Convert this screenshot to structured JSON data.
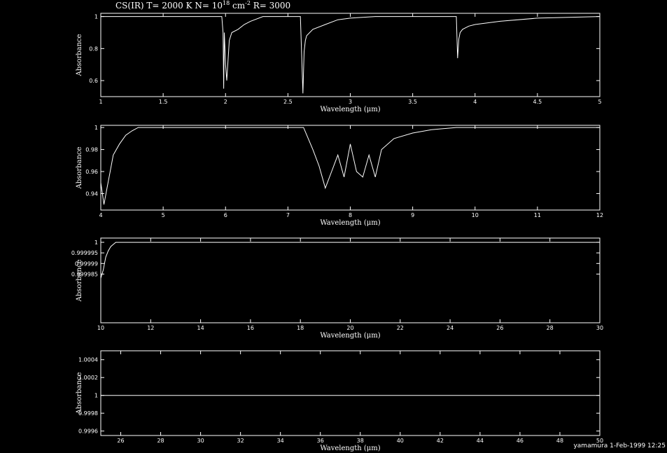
{
  "header": {
    "title_pre": "CS(IR) T= 2000 K N= 10",
    "title_exp1": "18",
    "title_mid": " cm",
    "title_exp2": "-2",
    "title_post": " R= 3000"
  },
  "footer": {
    "credit": "yamamura  1-Feb-1999 12:25"
  },
  "colors": {
    "background": "#000000",
    "foreground": "#ffffff"
  },
  "chart_data": [
    {
      "type": "line",
      "xlabel": "Wavelength (μm)",
      "ylabel": "Absorbance",
      "xlim": [
        1,
        5
      ],
      "ylim": [
        0.5,
        1.02
      ],
      "xticks": [
        1,
        1.5,
        2,
        2.5,
        3,
        3.5,
        4,
        4.5,
        5
      ],
      "xtick_labels": [
        "1",
        "1.5",
        "2",
        "2.5",
        "3",
        "3.5",
        "4",
        "4.5",
        "5"
      ],
      "yticks": [
        0.6,
        0.8,
        1
      ],
      "ytick_labels": [
        "0.6",
        "0.8",
        "1"
      ],
      "series": [
        {
          "x": [
            1.0,
            1.97,
            1.98,
            1.985,
            1.99,
            2.0,
            2.01,
            2.03,
            2.05,
            2.1,
            2.15,
            2.2,
            2.3,
            2.6,
            2.62,
            2.63,
            2.64,
            2.65,
            2.7,
            2.8,
            2.9,
            3.0,
            3.2,
            3.85,
            3.86,
            3.87,
            3.88,
            3.9,
            3.95,
            4.0,
            4.2,
            4.5,
            5.0
          ],
          "y": [
            1.0,
            1.0,
            0.9,
            0.55,
            0.9,
            0.7,
            0.6,
            0.85,
            0.9,
            0.92,
            0.95,
            0.97,
            1.0,
            1.0,
            0.52,
            0.78,
            0.85,
            0.88,
            0.92,
            0.95,
            0.98,
            0.99,
            1.0,
            1.0,
            0.74,
            0.86,
            0.9,
            0.92,
            0.94,
            0.95,
            0.97,
            0.99,
            1.0
          ]
        }
      ]
    },
    {
      "type": "line",
      "xlabel": "Wavelength (μm)",
      "ylabel": "Absorbance",
      "xlim": [
        4,
        12
      ],
      "ylim": [
        0.925,
        1.002
      ],
      "xticks": [
        4,
        5,
        6,
        7,
        8,
        9,
        10,
        11,
        12
      ],
      "xtick_labels": [
        "4",
        "5",
        "6",
        "7",
        "8",
        "9",
        "10",
        "11",
        "12"
      ],
      "yticks": [
        0.94,
        0.96,
        0.98,
        1
      ],
      "ytick_labels": [
        "0.94",
        "0.96",
        "0.98",
        "1"
      ],
      "series": [
        {
          "x": [
            4.0,
            4.05,
            4.1,
            4.15,
            4.2,
            4.3,
            4.4,
            4.5,
            4.6,
            7.25,
            7.4,
            7.5,
            7.6,
            7.7,
            7.8,
            7.9,
            8.0,
            8.1,
            8.2,
            8.3,
            8.4,
            8.5,
            8.7,
            9.0,
            9.3,
            9.7,
            12.0
          ],
          "y": [
            0.95,
            0.93,
            0.945,
            0.96,
            0.975,
            0.985,
            0.993,
            0.997,
            1.0,
            1.0,
            0.98,
            0.965,
            0.945,
            0.96,
            0.975,
            0.955,
            0.985,
            0.96,
            0.955,
            0.975,
            0.955,
            0.98,
            0.99,
            0.995,
            0.998,
            1.0,
            1.0
          ]
        }
      ]
    },
    {
      "type": "line",
      "xlabel": "Wavelength (μm)",
      "ylabel": "Absorbance",
      "xlim": [
        10,
        30
      ],
      "ylim": [
        0.999962,
        1.000002
      ],
      "xticks": [
        10,
        12,
        14,
        16,
        18,
        20,
        22,
        24,
        26,
        28,
        30
      ],
      "xtick_labels": [
        "10",
        "12",
        "14",
        "16",
        "18",
        "20",
        "22",
        "24",
        "26",
        "28",
        "30"
      ],
      "yticks": [
        0.999985,
        0.99999,
        0.999995,
        1
      ],
      "ytick_labels": [
        "0.999985",
        "0.99999",
        "0.999995",
        "1"
      ],
      "series": [
        {
          "x": [
            10.0,
            10.05,
            10.1,
            10.15,
            10.2,
            10.3,
            10.4,
            10.5,
            10.6,
            10.7,
            30.0
          ],
          "y": [
            0.999983,
            0.999985,
            0.999987,
            0.99999,
            0.999993,
            0.999996,
            0.999998,
            0.999999,
            1.0,
            1.0,
            1.0
          ]
        }
      ]
    },
    {
      "type": "line",
      "xlabel": "Wavelength (μm)",
      "ylabel": "Absorbance",
      "xlim": [
        25,
        50
      ],
      "ylim": [
        0.99955,
        1.0005
      ],
      "xticks": [
        26,
        28,
        30,
        32,
        34,
        36,
        38,
        40,
        42,
        44,
        46,
        48,
        50
      ],
      "xtick_labels": [
        "26",
        "28",
        "30",
        "32",
        "34",
        "36",
        "38",
        "40",
        "42",
        "44",
        "46",
        "48",
        "50"
      ],
      "yticks": [
        0.9996,
        0.9998,
        1,
        1.0002,
        1.0004
      ],
      "ytick_labels": [
        "0.9996",
        "0.9998",
        "1",
        "1.0002",
        "1.0004"
      ],
      "series": [
        {
          "x": [
            25.0,
            50.0
          ],
          "y": [
            1.0,
            1.0
          ]
        }
      ]
    }
  ]
}
